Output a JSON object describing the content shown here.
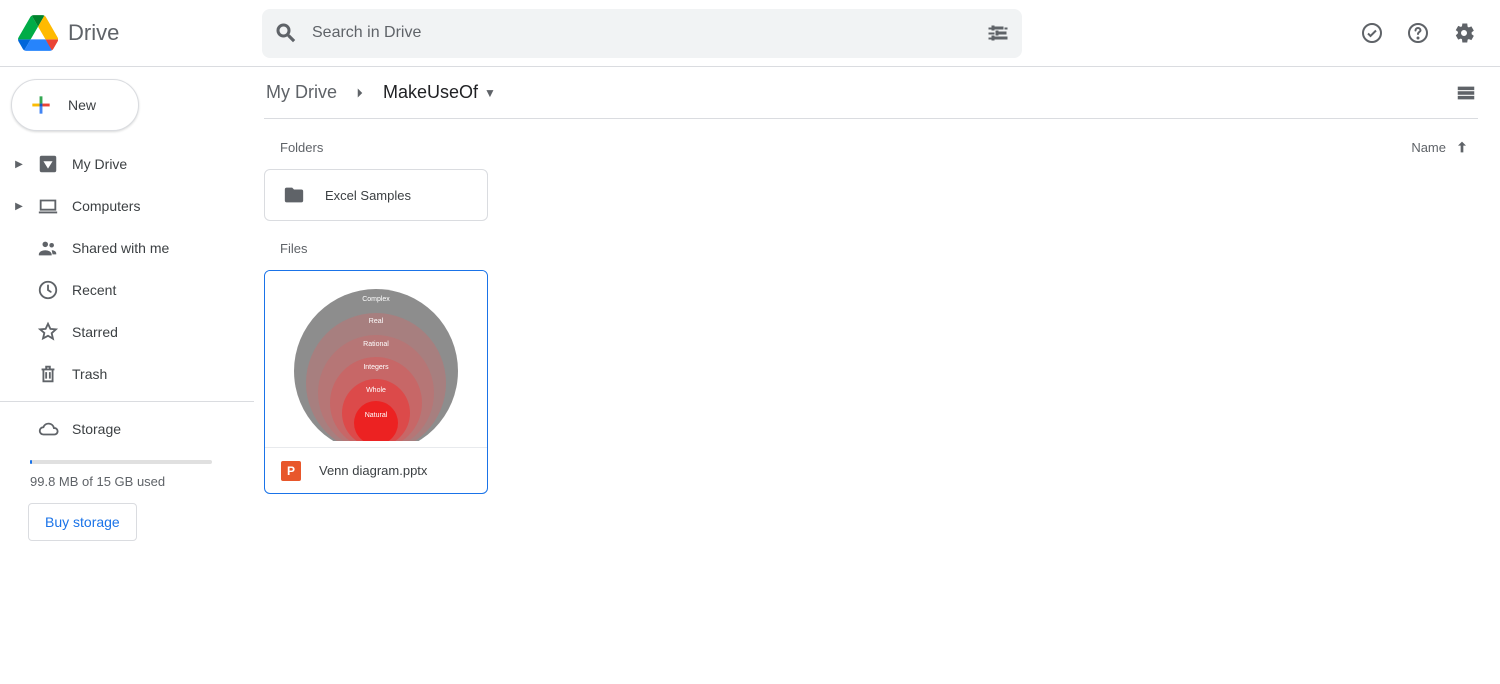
{
  "app": {
    "name": "Drive"
  },
  "search": {
    "placeholder": "Search in Drive"
  },
  "newButton": {
    "label": "New"
  },
  "sidebar": {
    "items": [
      {
        "label": "My Drive"
      },
      {
        "label": "Computers"
      },
      {
        "label": "Shared with me"
      },
      {
        "label": "Recent"
      },
      {
        "label": "Starred"
      },
      {
        "label": "Trash"
      }
    ],
    "storage": {
      "label": "Storage",
      "usage_text": "99.8 MB of 15 GB used",
      "buy_label": "Buy storage"
    }
  },
  "breadcrumb": {
    "root": "My Drive",
    "current": "MakeUseOf"
  },
  "sections": {
    "folders_label": "Folders",
    "files_label": "Files"
  },
  "sort": {
    "column": "Name",
    "direction": "asc"
  },
  "folders": [
    {
      "name": "Excel Samples"
    }
  ],
  "files": [
    {
      "name": "Venn diagram.pptx",
      "type": "pptx",
      "badge": "P",
      "thumbnail_rings": [
        "Complex",
        "Real",
        "Rational",
        "Integers",
        "Whole",
        "Natural"
      ]
    }
  ]
}
